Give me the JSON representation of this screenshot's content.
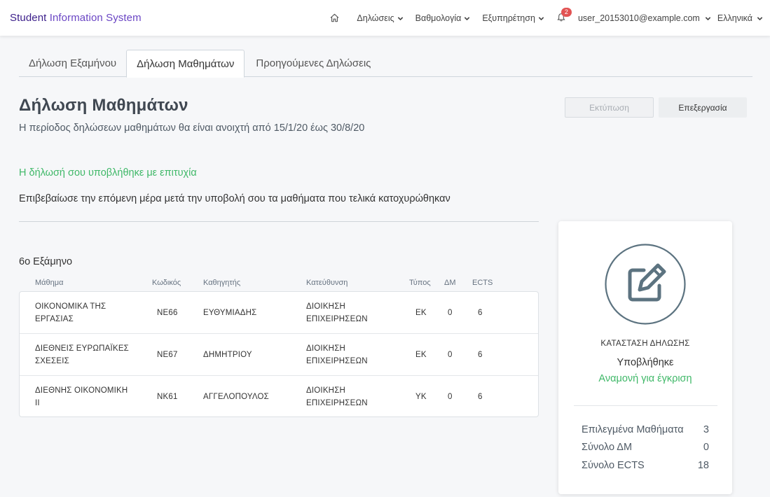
{
  "brand": {
    "part1": "Student",
    "part2": " Information System"
  },
  "nav": {
    "items": [
      {
        "label": "Δηλώσεις"
      },
      {
        "label": "Βαθμολογία"
      },
      {
        "label": "Εξυπηρέτηση"
      }
    ],
    "notifications_count": "2",
    "user": "user_20153010@example.com",
    "language": "Ελληνικά"
  },
  "tabs": [
    {
      "label": "Δήλωση Εξαμήνου"
    },
    {
      "label": "Δήλωση Μαθημάτων"
    },
    {
      "label": "Προηγούμενες Δηλώσεις"
    }
  ],
  "page": {
    "title": "Δήλωση Μαθημάτων",
    "period": "Η περίοδος δηλώσεων μαθημάτων θα είναι ανοιχτή από 15/1/20 έως 30/8/20",
    "print_label": "Εκτύπωση",
    "edit_label": "Επεξεργασία",
    "success": "Η δήλωσή σου υποβλήθηκε με επιτυχία",
    "confirm": "Επιβεβαίωσε την επόμενη μέρα μετά την υποβολή σου τα μαθήματα που τελικά κατοχυρώθηκαν",
    "semester": "6ο Εξάμηνο"
  },
  "table": {
    "headers": {
      "course": "Μάθημα",
      "code": "Κωδικός",
      "professor": "Καθηγητής",
      "direction": "Κατεύθυνση",
      "type": "Τύπος",
      "dm": "ΔΜ",
      "ects": "ECTS"
    },
    "rows": [
      {
        "course1": "ΟΙΚΟΝΟΜΙΚΑ ΤΗΣ",
        "course2": "ΕΡΓΑΣΙΑΣ",
        "code": "ΝΕ66",
        "professor": "ΕΥΘΥΜΙΑΔΗΣ",
        "direction1": "ΔΙΟΙΚΗΣΗ",
        "direction2": "ΕΠΙΧΕΙΡΗΣΕΩΝ",
        "type": "ΕΚ",
        "dm": "0",
        "ects": "6"
      },
      {
        "course1": "ΔΙΕΘΝΕΙΣ ΕΥΡΩΠΑΪΚΕΣ",
        "course2": "ΣΧΕΣΕΙΣ",
        "code": "ΝΕ67",
        "professor": "ΔΗΜΗΤΡΙΟΥ",
        "direction1": "ΔΙΟΙΚΗΣΗ",
        "direction2": "ΕΠΙΧΕΙΡΗΣΕΩΝ",
        "type": "ΕΚ",
        "dm": "0",
        "ects": "6"
      },
      {
        "course1": "ΔΙΕΘΝΗΣ ΟΙΚΟΝΟΜΙΚΗ",
        "course2": "ΙΙ",
        "code": "ΝΚ61",
        "professor": "ΑΓΓΕΛΟΠΟΥΛΟΣ",
        "direction1": "ΔΙΟΙΚΗΣΗ",
        "direction2": "ΕΠΙΧΕΙΡΗΣΕΩΝ",
        "type": "ΥΚ",
        "dm": "0",
        "ects": "6"
      }
    ]
  },
  "status_card": {
    "icon": "edit-document-icon",
    "label": "ΚΑΤΑΣΤΑΣΗ ΔΗΛΩΣΗΣ",
    "status": "Υποβλήθηκε",
    "awaiting": "Αναμονή για έγκριση",
    "summary": [
      {
        "label": "Επιλεγμένα Μαθήματα",
        "value": "3"
      },
      {
        "label": "Σύνολο ΔΜ",
        "value": "0"
      },
      {
        "label": "Σύνολο ECTS",
        "value": "18"
      }
    ]
  },
  "colors": {
    "accent_green": "#3fb868",
    "brand_dark": "#3b1e8a",
    "brand_light": "#6a45c4",
    "badge_red": "#e25353",
    "icon_slate": "#5c7380"
  }
}
